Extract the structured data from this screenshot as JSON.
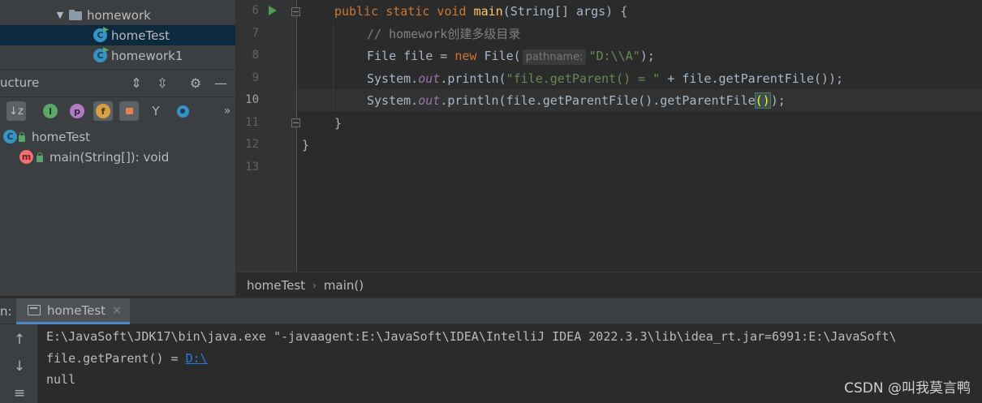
{
  "project_tree": {
    "items": [
      {
        "label": "homework"
      },
      {
        "label": "homeTest"
      },
      {
        "label": "homework1"
      }
    ]
  },
  "structure": {
    "title": "ucture",
    "class_item": "homeTest",
    "method_item": "main(String[]): void",
    "toolbar": {
      "sort_alpha_icon": "sort-alpha-icon",
      "inherited_icon": "inherited-icon",
      "properties_icon": "p",
      "fields_icon": "f",
      "non_public_icon": "lock-icon",
      "lambdas_icon": "lambda-icon",
      "anonymous_icon": "anonymous-icon",
      "more": "»"
    }
  },
  "editor": {
    "line_numbers": [
      "6",
      "7",
      "8",
      "9",
      "10",
      "11",
      "12",
      "13"
    ],
    "current_line": "10",
    "lines": {
      "l6": {
        "kw": "public static void",
        "fn": "main",
        "rest": "(String[] args) {"
      },
      "l7": {
        "comment": "// homework创建多级目录"
      },
      "l8": {
        "pre": "File file = ",
        "kw": "new",
        "post": " File(",
        "hint": "pathname:",
        "str": "\"D:\\\\A\"",
        "end": ");"
      },
      "l9": {
        "pre": "System.",
        "static": "out",
        "mid": ".println(",
        "str": "\"file.getParent() = \"",
        "end": " + file.getParentFile());"
      },
      "l10": {
        "pre": "System.",
        "static": "out",
        "mid": ".println(file.getParentFile().getParentFile",
        "match": "()",
        "end": ");"
      },
      "l11": {
        "text": "}"
      },
      "l12": {
        "text": "}"
      }
    }
  },
  "breadcrumb": {
    "items": [
      "homeTest",
      "main()"
    ],
    "separator": "›"
  },
  "run": {
    "label": "n:",
    "tab": "homeTest",
    "tab_close": "×",
    "console": {
      "line1": "E:\\JavaSoft\\JDK17\\bin\\java.exe \"-javaagent:E:\\JavaSoft\\IDEA\\IntelliJ IDEA 2022.3.3\\lib\\idea_rt.jar=6991:E:\\JavaSoft\\",
      "line2_prefix": "file.getParent() = ",
      "line2_link": "D:\\",
      "line3": "null"
    }
  },
  "watermark": "CSDN @叫我莫言鸭",
  "colors": {
    "background": "#2b2b2b",
    "panel": "#3c3f41",
    "selection": "#0d293e",
    "keyword": "#cc7832",
    "function": "#ffc66d",
    "string": "#6a8759",
    "link": "#287bde"
  }
}
